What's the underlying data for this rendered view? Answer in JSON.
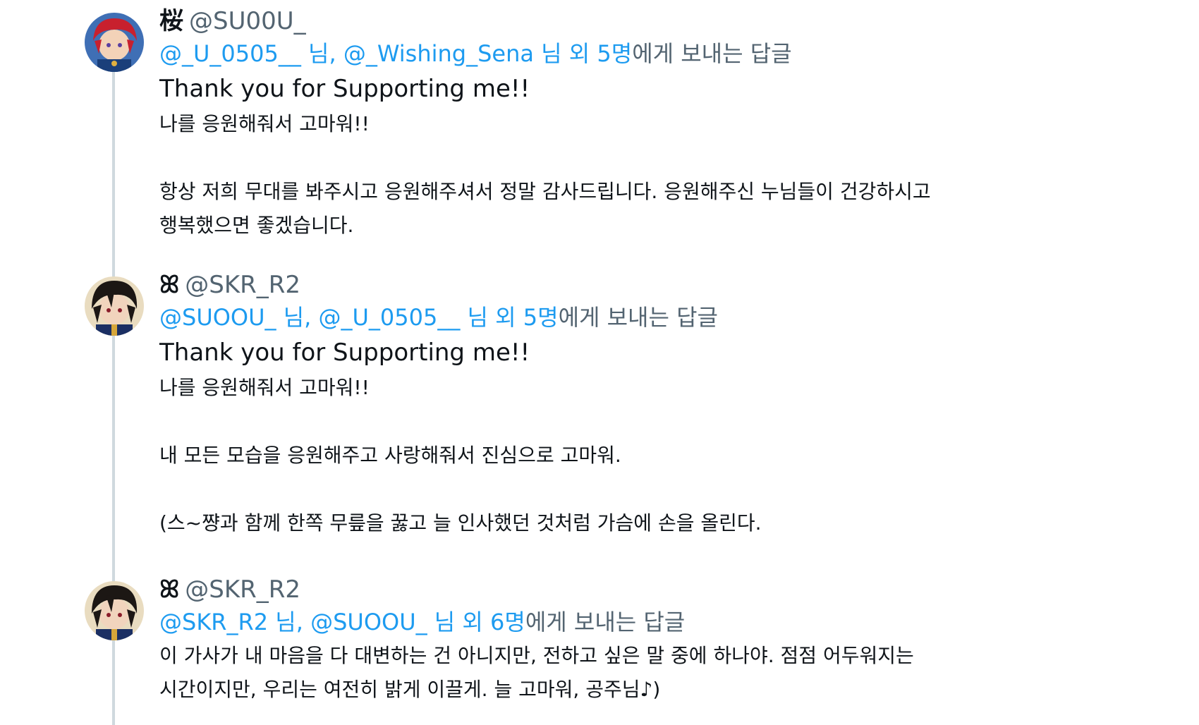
{
  "tweets": [
    {
      "display_name": "桜",
      "handle": "@SU00U_",
      "reply_mentions": [
        "@_U_0505__",
        "@_Wishing_Sena"
      ],
      "reply_sep": " 님, ",
      "reply_more": " 님 외 5명",
      "reply_suffix": "에게 보내는 답글",
      "title_en": "Thank you for Supporting me!!",
      "title_ko": "나를 응원해줘서 고마워!!",
      "body_1": "항상 저희 무대를 봐주시고 응원해주셔서 정말 감사드립니다. 응원해주신 누님들이 건강하시고",
      "body_2": "행복했으면 좋겠습니다."
    },
    {
      "display_name": "ꕤ",
      "handle": "@SKR_R2",
      "reply_mentions": [
        "@SUOOU_",
        "@_U_0505__"
      ],
      "reply_sep": " 님, ",
      "reply_more": " 님 외 5명",
      "reply_suffix": "에게 보내는 답글",
      "title_en": "Thank you for Supporting me!!",
      "title_ko": "나를 응원해줘서 고마워!!",
      "body_1": "내 모든 모습을 응원해주고 사랑해줘서 진심으로 고마워.",
      "body_2": "(스~쨩과 함께 한쪽 무릎을 꿇고 늘 인사했던 것처럼 가슴에 손을 올린다."
    },
    {
      "display_name": "ꕤ",
      "handle": "@SKR_R2",
      "reply_mentions": [
        "@SKR_R2",
        "@SUOOU_"
      ],
      "reply_sep": " 님, ",
      "reply_more": " 님 외 6명",
      "reply_suffix": "에게 보내는 답글",
      "body_1": "이 가사가 내 마음을 다 대변하는 건 아니지만, 전하고 싶은 말 중에 하나야. 점점 어두워지는",
      "body_2": "시간이지만, 우리는 여전히 밝게 이끌게. 늘 고마워, 공주님♪)"
    }
  ],
  "colors": {
    "link": "#1d9bf0",
    "muted": "#536471",
    "text": "#0f1419",
    "thread_line": "#cfd9de"
  }
}
